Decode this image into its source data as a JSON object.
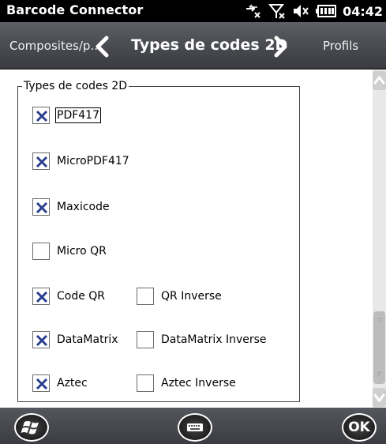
{
  "status_bar": {
    "app_title": "Barcode Connector",
    "time": "04:42",
    "icons": [
      "connection-icon",
      "signal-icon",
      "volume-icon",
      "battery-icon"
    ]
  },
  "nav": {
    "previous": "Composites/p...",
    "current": "Types de codes 2D",
    "next": "Profils"
  },
  "group": {
    "title": "Types de codes 2D"
  },
  "options": [
    {
      "label": "PDF417",
      "checked": true
    },
    {
      "label": "MicroPDF417",
      "checked": true
    },
    {
      "label": "Maxicode",
      "checked": true
    },
    {
      "label": "Micro QR",
      "checked": false
    },
    {
      "label": "Code QR",
      "checked": true
    },
    {
      "label": "QR Inverse",
      "checked": false
    },
    {
      "label": "DataMatrix",
      "checked": true
    },
    {
      "label": "DataMatrix Inverse",
      "checked": false
    },
    {
      "label": "Aztec",
      "checked": true
    },
    {
      "label": "Aztec Inverse",
      "checked": false
    }
  ],
  "softkeys": {
    "start_icon": "windows-start-icon",
    "keyboard_icon": "keyboard-icon",
    "ok": "OK"
  },
  "colors": {
    "check_blue": "#2b3f8f",
    "header_dark": "#4b4d53"
  }
}
